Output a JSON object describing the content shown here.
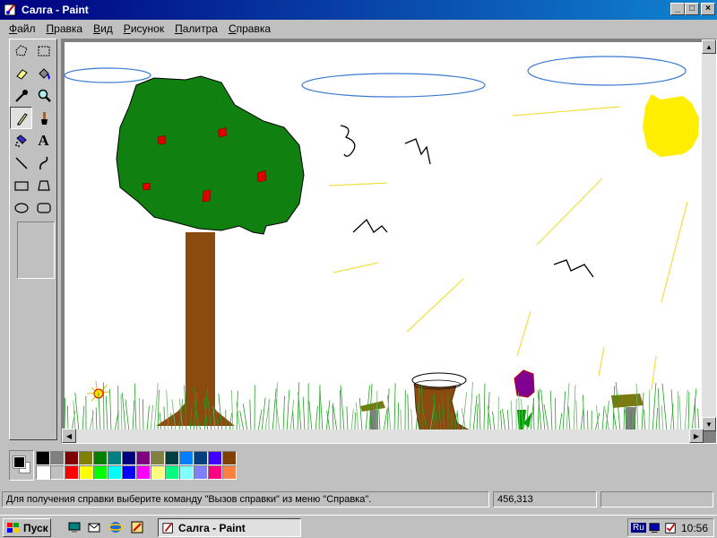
{
  "window": {
    "title": "Салга - Paint"
  },
  "menu": [
    "Файл",
    "Правка",
    "Вид",
    "Рисунок",
    "Палитра",
    "Справка"
  ],
  "tools": [
    {
      "name": "free-select"
    },
    {
      "name": "rect-select"
    },
    {
      "name": "eraser"
    },
    {
      "name": "fill"
    },
    {
      "name": "color-picker"
    },
    {
      "name": "magnifier"
    },
    {
      "name": "pencil"
    },
    {
      "name": "brush"
    },
    {
      "name": "airbrush"
    },
    {
      "name": "text"
    },
    {
      "name": "line"
    },
    {
      "name": "curve"
    },
    {
      "name": "rectangle"
    },
    {
      "name": "polygon"
    },
    {
      "name": "ellipse"
    },
    {
      "name": "rounded-rect"
    }
  ],
  "active_tool": "pencil",
  "text_tool_glyph": "A",
  "colors": {
    "foreground": "#000000",
    "background": "#ffffff",
    "palette_row1": [
      "#000000",
      "#808080",
      "#800000",
      "#808000",
      "#008000",
      "#008080",
      "#000080",
      "#800080",
      "#808040",
      "#004040",
      "#0080ff",
      "#004080",
      "#4000ff",
      "#804000"
    ],
    "palette_row2": [
      "#ffffff",
      "#c0c0c0",
      "#ff0000",
      "#ffff00",
      "#00ff00",
      "#00ffff",
      "#0000ff",
      "#ff00ff",
      "#ffff80",
      "#00ff80",
      "#80ffff",
      "#8080ff",
      "#ff0080",
      "#ff8040"
    ]
  },
  "status": {
    "help_text": "Для получения справки выберите команду \"Вызов справки\" из меню \"Справка\".",
    "coordinates": "456,313",
    "size": ""
  },
  "taskbar": {
    "start_label": "Пуск",
    "task_label": "Салга - Paint",
    "language": "Ru",
    "clock": "10:56"
  }
}
